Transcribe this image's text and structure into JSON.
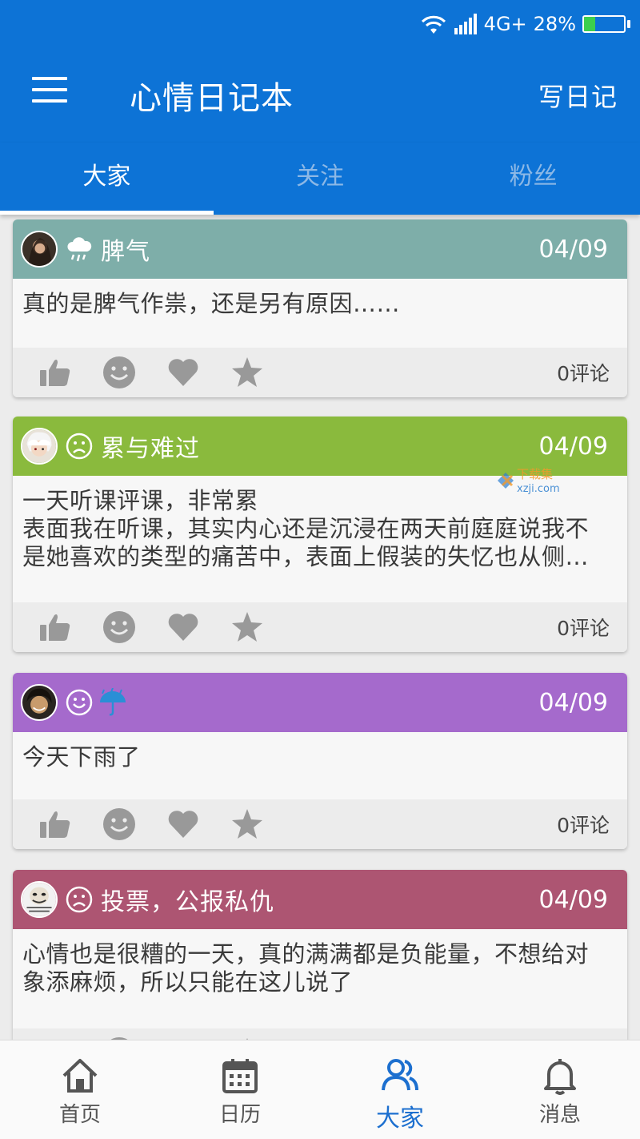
{
  "status_bar": {
    "network": "4G+",
    "battery_percent": "28%",
    "battery_level": 0.28,
    "battery_color": "#3ccf4e"
  },
  "app_bar": {
    "title": "心情日记本",
    "action_label": "写日记",
    "background": "#0d73d6"
  },
  "tabs": [
    {
      "label": "大家",
      "active": true
    },
    {
      "label": "关注",
      "active": false
    },
    {
      "label": "粉丝",
      "active": false
    }
  ],
  "posts": [
    {
      "title": "脾气",
      "date": "04/09",
      "header_color": "#7eaea9",
      "mood_icon": "rain-cloud-icon",
      "weather_icon": "",
      "body": "真的是脾气作祟，还是另有原因……",
      "comments": "0评论"
    },
    {
      "title": "累与难过",
      "date": "04/09",
      "header_color": "#8aba3d",
      "mood_icon": "sad-face-icon",
      "weather_icon": "",
      "body_lines": [
        "一天听课评课，非常累",
        "表面我在听课，其实内心还是沉浸在两天前庭庭说我不",
        "是她喜欢的类型的痛苦中，表面上假装的失忆也从侧…"
      ],
      "comments": "0评论"
    },
    {
      "title": "",
      "date": "04/09",
      "header_color": "#a56acc",
      "mood_icon": "happy-face-icon",
      "weather_icon": "umbrella-rain-icon",
      "body": "今天下雨了",
      "comments": "0评论"
    },
    {
      "title": "投票，公报私仇",
      "date": "04/09",
      "header_color": "#ad5572",
      "mood_icon": "sad-face-icon",
      "weather_icon": "",
      "body_lines": [
        "心情也是很糟的一天，真的满满都是负能量，不想给对",
        "象添麻烦，所以只能在这儿说了"
      ],
      "comments": ""
    }
  ],
  "watermark": {
    "text_cn": "下载集",
    "text_en": "xzji.com"
  },
  "bottom_nav": [
    {
      "label": "首页",
      "icon": "home-icon",
      "active": false
    },
    {
      "label": "日历",
      "icon": "calendar-icon",
      "active": false
    },
    {
      "label": "大家",
      "icon": "people-icon",
      "active": true
    },
    {
      "label": "消息",
      "icon": "bell-icon",
      "active": false
    }
  ]
}
